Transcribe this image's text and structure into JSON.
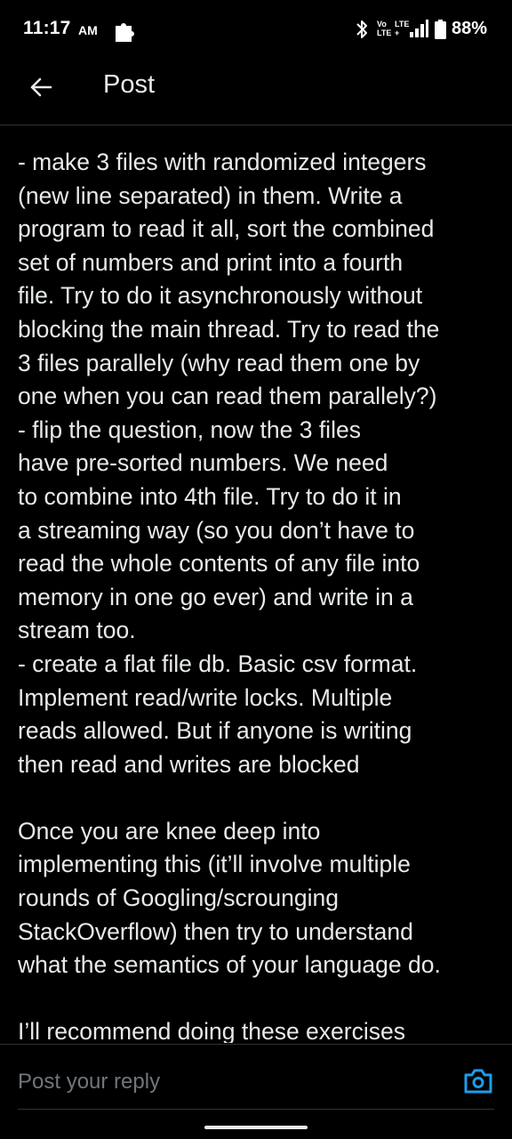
{
  "status_bar": {
    "time": "11:17",
    "ampm": "AM",
    "volte": "Vo\nLTE",
    "lte": "LTE\n+",
    "battery": "88%"
  },
  "header": {
    "title": "Post"
  },
  "post": {
    "lines": [
      "- make 3 files with randomized integers",
      "(new line separated) in them. Write a",
      "program to read it all, sort the combined",
      "set of numbers and print into a fourth",
      "file. Try to do it asynchronously without",
      "blocking the main thread. Try to read the",
      "3 files parallely (why read them one by",
      "one when you can read them parallely?)",
      "- flip the question, now the 3 files",
      "have pre-sorted numbers. We need",
      "to combine into 4th file. Try to do it in",
      "a streaming way (so you don’t have to",
      "read the whole contents of any file into",
      "memory in one go ever) and write in a",
      "stream too.",
      "- create a flat file db. Basic csv format.",
      "Implement read/write locks. Multiple",
      "reads allowed. But if anyone is writing",
      "then read and writes are blocked",
      "",
      "Once you are knee deep into",
      "implementing this (it’ll involve multiple",
      "rounds of Googling/scrounging",
      "StackOverflow) then try to understand",
      "what the semantics of your language do.",
      "",
      "I’ll recommend doing these exercises"
    ]
  },
  "reply": {
    "placeholder": "Post your reply"
  },
  "colors": {
    "background": "#000000",
    "text": "#e7e9ea",
    "muted": "#71767b",
    "accent": "#1d9bf0",
    "divider": "#2f3336"
  },
  "icons": {
    "back": "arrow-left-icon",
    "camera": "camera-icon",
    "bluetooth": "bluetooth-icon",
    "signal": "signal-icon",
    "battery": "battery-icon",
    "notification": "puzzle-icon"
  }
}
